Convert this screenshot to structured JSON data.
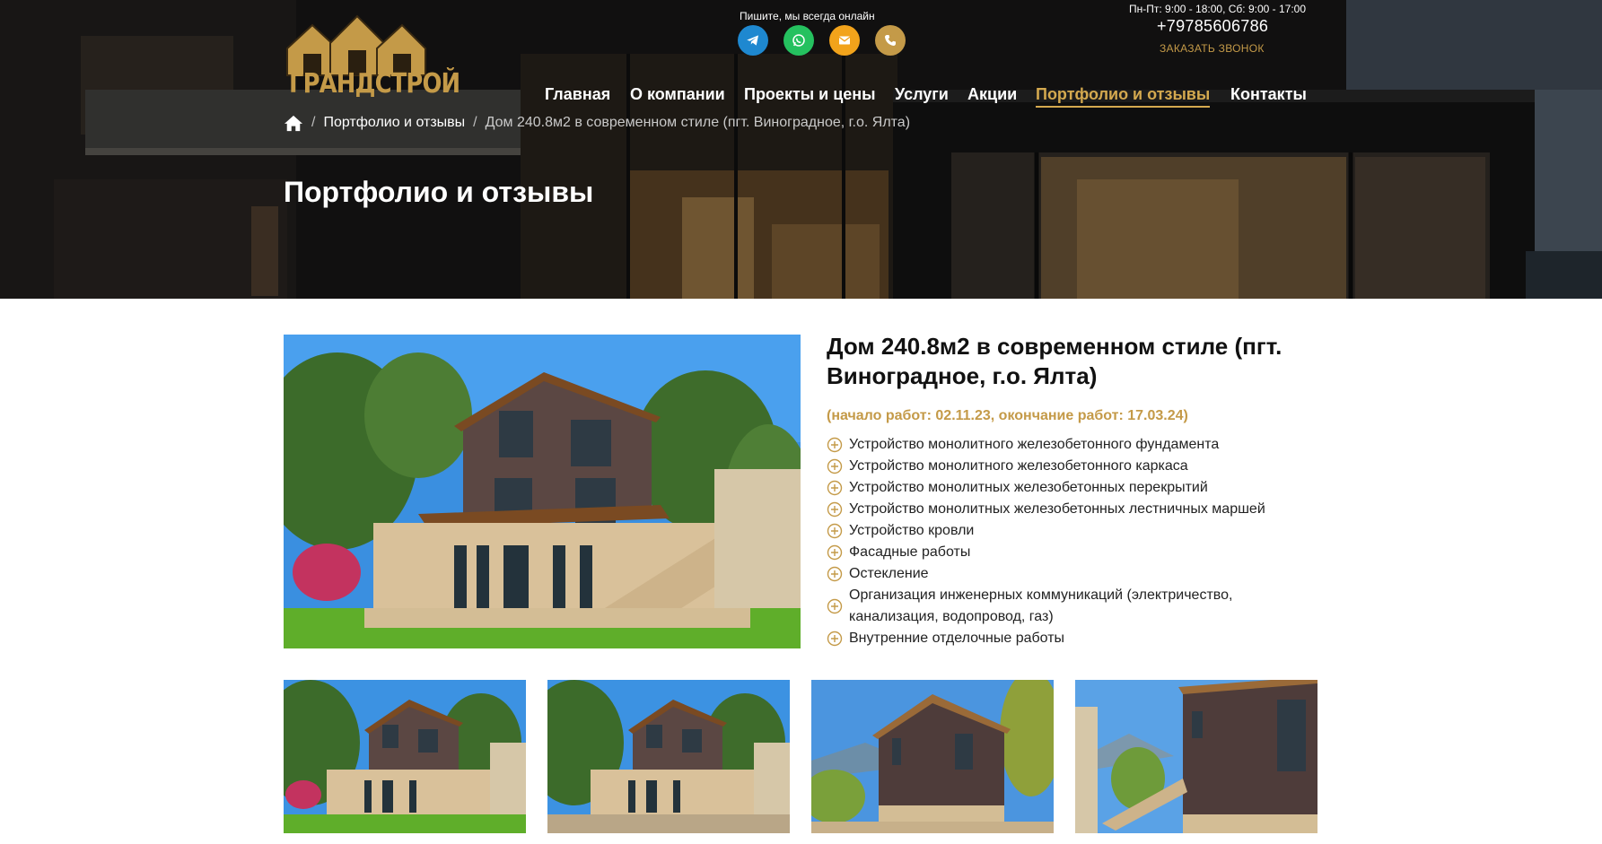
{
  "header": {
    "logo_text": "ГРАНДСТРОЙ",
    "online_caption": "Пишите, мы всегда онлайн",
    "social": [
      {
        "icon": "telegram-icon",
        "color": "#1e88d0"
      },
      {
        "icon": "whatsapp-icon",
        "color": "#25c15f"
      },
      {
        "icon": "email-icon",
        "color": "#f2a31b"
      },
      {
        "icon": "phone-icon",
        "color": "#c49a48"
      }
    ],
    "hours": "Пн-Пт: 9:00 - 18:00, Сб: 9:00 - 17:00",
    "phone": "+79785606786",
    "callback": "ЗАКАЗАТЬ ЗВОНОК"
  },
  "nav": {
    "items": [
      {
        "label": "Главная"
      },
      {
        "label": "О компании"
      },
      {
        "label": "Проекты и цены"
      },
      {
        "label": "Услуги"
      },
      {
        "label": "Акции"
      },
      {
        "label": "Портфолио и отзывы",
        "active": true
      },
      {
        "label": "Контакты"
      }
    ]
  },
  "breadcrumb": {
    "separator": "/",
    "items": [
      {
        "label": "Портфолио и отзывы"
      },
      {
        "label": "Дом 240.8м2 в современном стиле (пгт. Виноградное, г.о. Ялта)"
      }
    ]
  },
  "page_title": "Портфолио и отзывы",
  "project": {
    "title": "Дом 240.8м2 в современном стиле (пгт. Виноградное, г.о. Ялта)",
    "dates": "(начало работ: 02.11.23, окончание работ: 17.03.24)",
    "works": [
      "Устройство монолитного железобетонного фундамента",
      "Устройство монолитного железобетонного каркаса",
      "Устройство монолитных железобетонных перекрытий",
      "Устройство монолитных железобетонных лестничных маршей",
      "Устройство кровли",
      "Фасадные работы",
      "Остекление",
      "Организация инженерных коммуникаций (электричество, канализация, водопровод, газ)",
      "Внутренние отделочные работы"
    ]
  },
  "colors": {
    "accent": "#c49a48",
    "active_nav": "#d4a94f"
  }
}
